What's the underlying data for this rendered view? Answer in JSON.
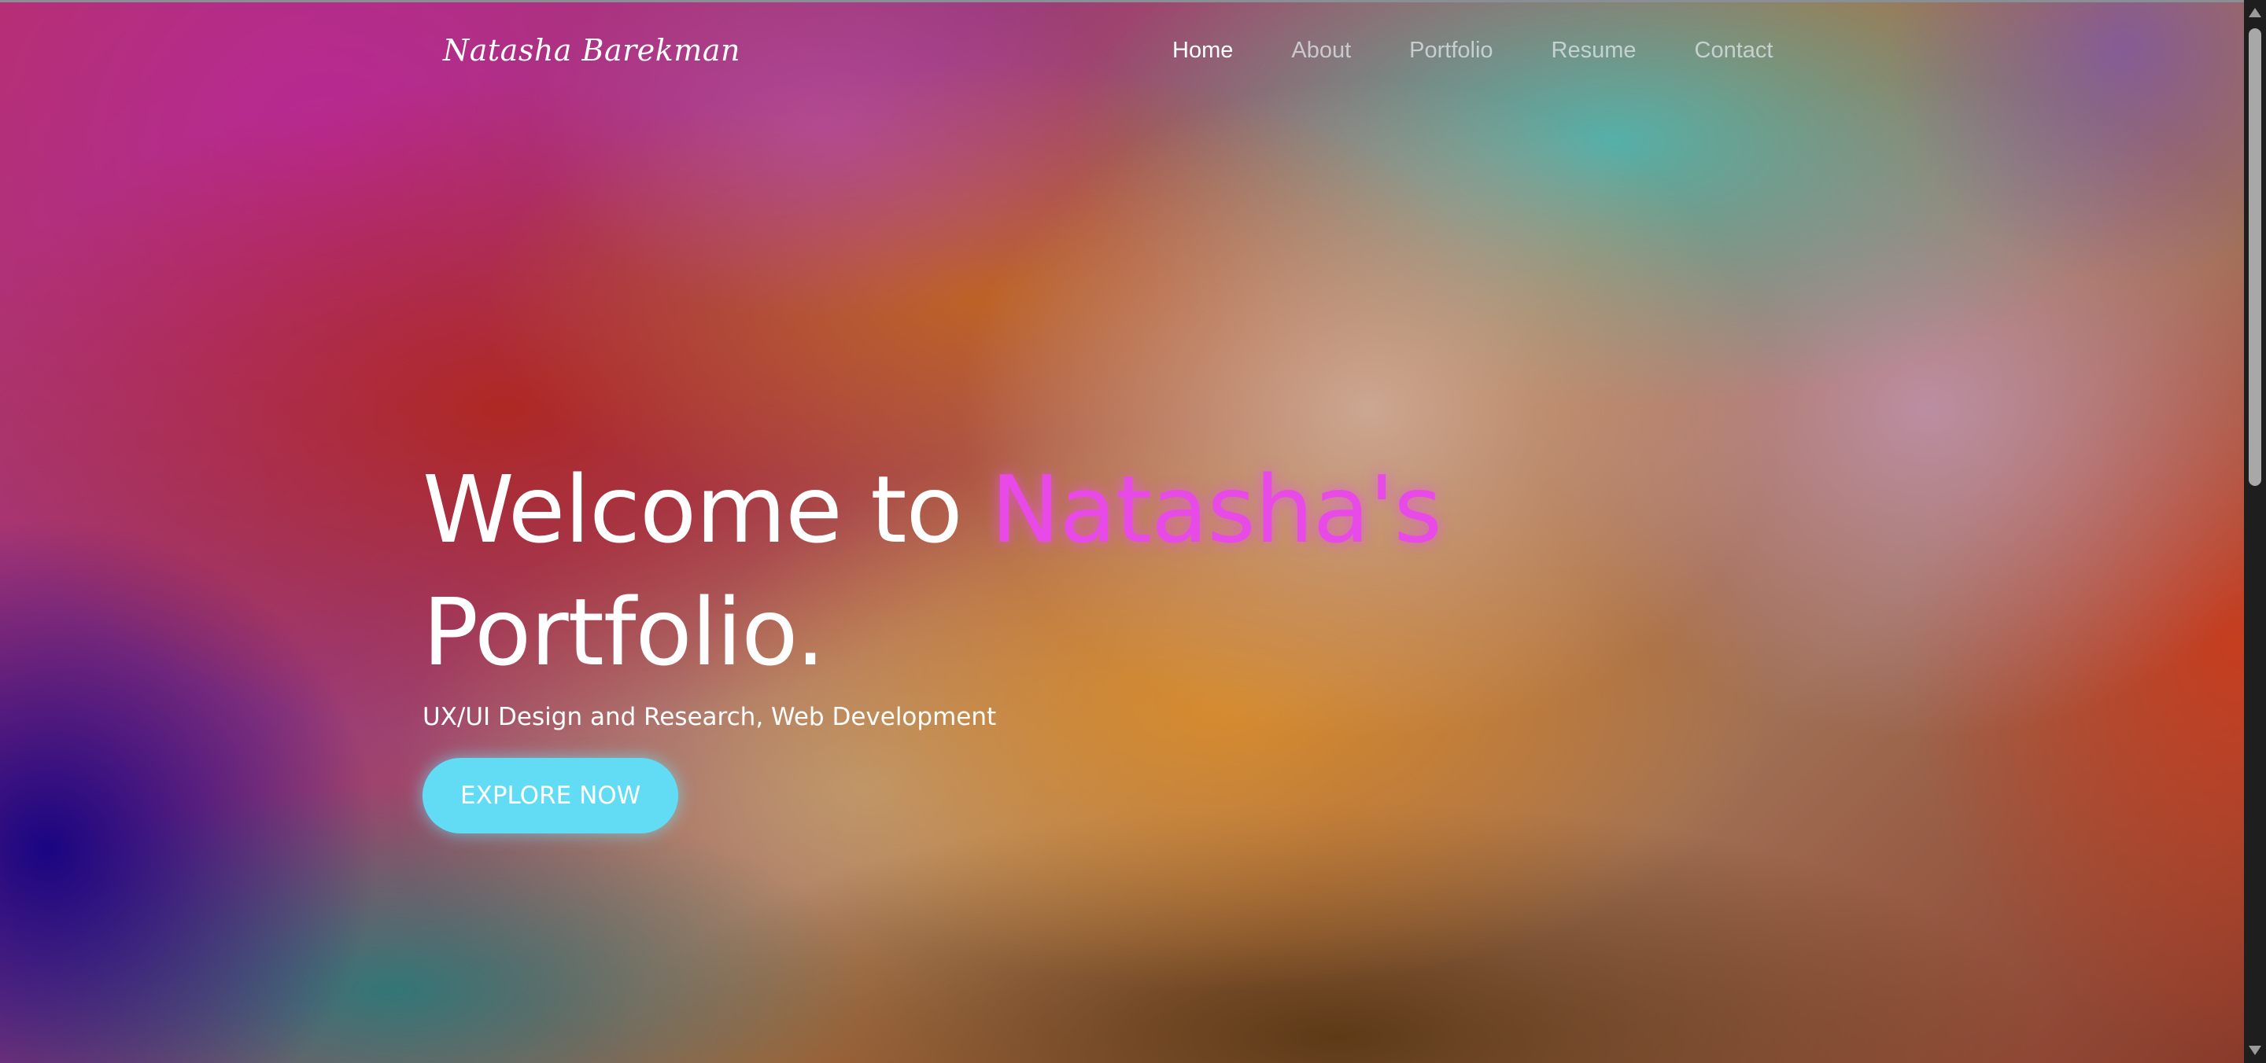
{
  "header": {
    "logo_text": "Natasha Barekman",
    "nav": [
      {
        "label": "Home",
        "active": true
      },
      {
        "label": "About",
        "active": false
      },
      {
        "label": "Portfolio",
        "active": false
      },
      {
        "label": "Resume",
        "active": false
      },
      {
        "label": "Contact",
        "active": false
      }
    ]
  },
  "hero": {
    "title_prefix": "Welcome to ",
    "title_highlight": "Natasha's",
    "title_suffix": "Portfolio.",
    "subtitle": "UX/UI Design and Research, Web Development",
    "cta_label": "EXPLORE NOW"
  },
  "colors": {
    "accent_pink": "#e74ae6",
    "cta_cyan": "#62dbf5",
    "text": "#ffffff"
  },
  "icons": {
    "scroll_up": "triangle-up",
    "scroll_down": "triangle-down"
  }
}
